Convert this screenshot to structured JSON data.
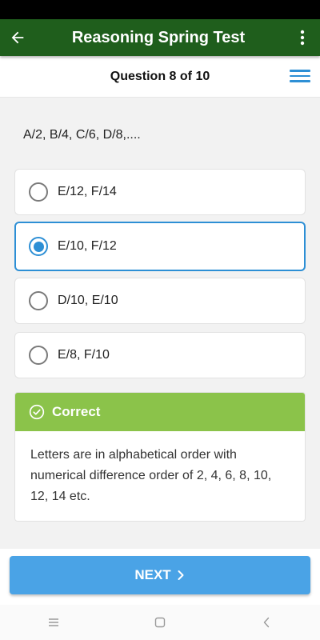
{
  "app_bar": {
    "title": "Reasoning Spring Test",
    "back_icon": "arrow-left-icon",
    "more_icon": "more-vert-icon",
    "color": "#1f5e1c"
  },
  "question_header": {
    "label": "Question 8 of 10",
    "menu_icon": "hamburger-menu-icon"
  },
  "question": {
    "text": "A/2, B/4, C/6, D/8,...."
  },
  "options": [
    {
      "label": "E/12, F/14",
      "selected": false
    },
    {
      "label": "E/10, F/12",
      "selected": true
    },
    {
      "label": "D/10, E/10",
      "selected": false
    },
    {
      "label": "E/8, F/10",
      "selected": false
    }
  ],
  "result": {
    "status": "Correct",
    "status_color": "#8bc34a",
    "icon": "check-circle-icon",
    "explanation": "Letters are in alphabetical order with numerical difference order of 2, 4, 6, 8, 10, 12, 14 etc."
  },
  "next_button": {
    "label": "NEXT",
    "icon": "chevron-right-icon",
    "color": "#4aa3e6"
  },
  "accent_color": "#2d8fd5",
  "system_nav": {
    "icons": [
      "recents-icon",
      "home-icon",
      "back-icon"
    ]
  }
}
